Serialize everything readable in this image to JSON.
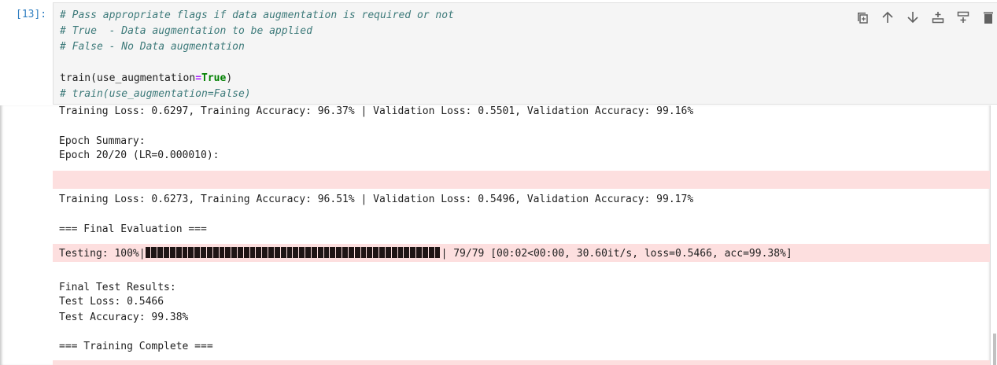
{
  "cell": {
    "prompt": "[13]:",
    "code": {
      "line1": "# Pass appropriate flags if data augmentation is required or not",
      "line2": "# True  - Data augmentation to be applied",
      "line3": "# False - No Data augmentation",
      "call_name": "train(use_augmentation",
      "call_eq": "=",
      "call_value": "True",
      "call_close": ")",
      "line6": "# train(use_augmentation=False)"
    },
    "toolbar": [
      "duplicate-icon",
      "move-up-icon",
      "move-down-icon",
      "insert-above-icon",
      "insert-below-icon",
      "delete-icon"
    ]
  },
  "output": {
    "line_prev_epoch": "Training Loss: 0.6297, Training Accuracy: 96.37% | Validation Loss: 0.5501, Validation Accuracy: 99.16%",
    "epoch_summary": "Epoch Summary:",
    "epoch_line": "Epoch 20/20 (LR=0.000010):",
    "epoch_result": "Training Loss: 0.6273, Training Accuracy: 96.51% | Validation Loss: 0.5496, Validation Accuracy: 99.17%",
    "final_eval": "=== Final Evaluation ===",
    "testing_prefix": "Testing: 100%|",
    "testing_progress": 1.0,
    "testing_suffix": "| 79/79 [00:02<00:00, 30.60it/s, loss=0.5466, acc=99.38%]",
    "final_results": "Final Test Results:",
    "test_loss": "Test Loss: 0.5466",
    "test_accuracy": "Test Accuracy: 99.38%",
    "training_complete": "=== Training Complete ==="
  },
  "colors": {
    "stderr_bg": "#fddfdf",
    "prompt": "#307fc1",
    "comment": "#3d7a7a",
    "keyword": "#008000"
  }
}
